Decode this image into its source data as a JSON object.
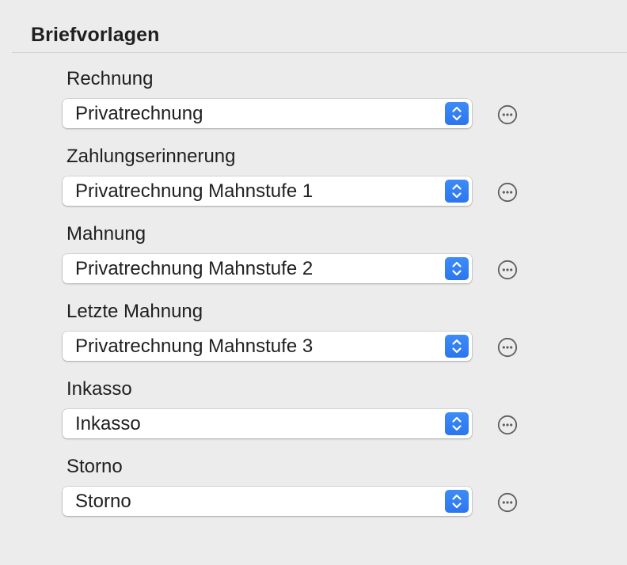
{
  "section": {
    "title": "Briefvorlagen"
  },
  "fields": [
    {
      "label": "Rechnung",
      "value": "Privatrechnung"
    },
    {
      "label": "Zahlungserinnerung",
      "value": "Privatrechnung Mahnstufe 1"
    },
    {
      "label": "Mahnung",
      "value": "Privatrechnung Mahnstufe 2"
    },
    {
      "label": "Letzte Mahnung",
      "value": "Privatrechnung Mahnstufe 3"
    },
    {
      "label": "Inkasso",
      "value": "Inkasso"
    },
    {
      "label": "Storno",
      "value": "Storno"
    }
  ],
  "icons": {
    "stepper": "up-down-chevron-icon",
    "more": "ellipsis-circle-icon"
  },
  "colors": {
    "accent": "#2f7cf0",
    "background": "#ececec"
  }
}
